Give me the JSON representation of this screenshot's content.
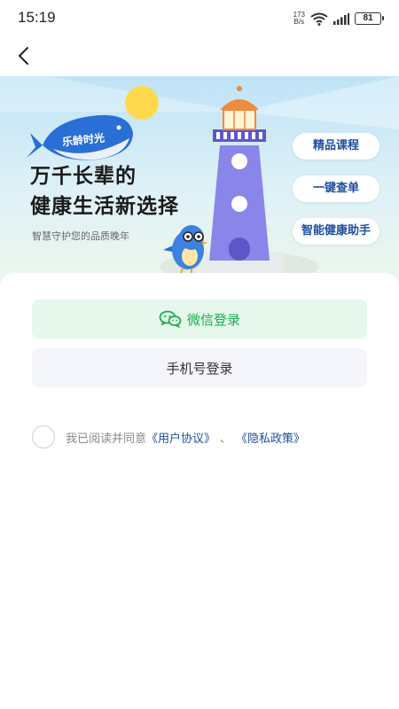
{
  "status_bar": {
    "time": "15:19",
    "net_speed_value": "173",
    "net_speed_unit": "B/s",
    "wifi_icon": "wifi-icon",
    "signal_icon": "signal-bars-icon",
    "battery_level": "81"
  },
  "nav": {
    "back_icon": "chevron-left-icon"
  },
  "banner": {
    "brand_name": "乐龄时光",
    "headline_line1": "万千长辈的",
    "headline_line2": "健康生活新选择",
    "subtitle": "智慧守护您的品质晚年",
    "features": [
      "精品课程",
      "一键查单",
      "智能健康助手"
    ],
    "colors": {
      "whale": "#2a6fd6",
      "sun": "#ffd94d",
      "lighthouse": "#8a85e8",
      "lighthouse_top": "#f08a3c",
      "pill_text": "#1e4fa0"
    }
  },
  "login": {
    "wechat_label": "微信登录",
    "phone_label": "手机号登录",
    "wechat_color": "#1aad4e"
  },
  "agreement": {
    "prefix": "我已阅读并同意",
    "user_agreement": "《用户协议》",
    "separator": "、",
    "privacy_policy": "《隐私政策》"
  }
}
